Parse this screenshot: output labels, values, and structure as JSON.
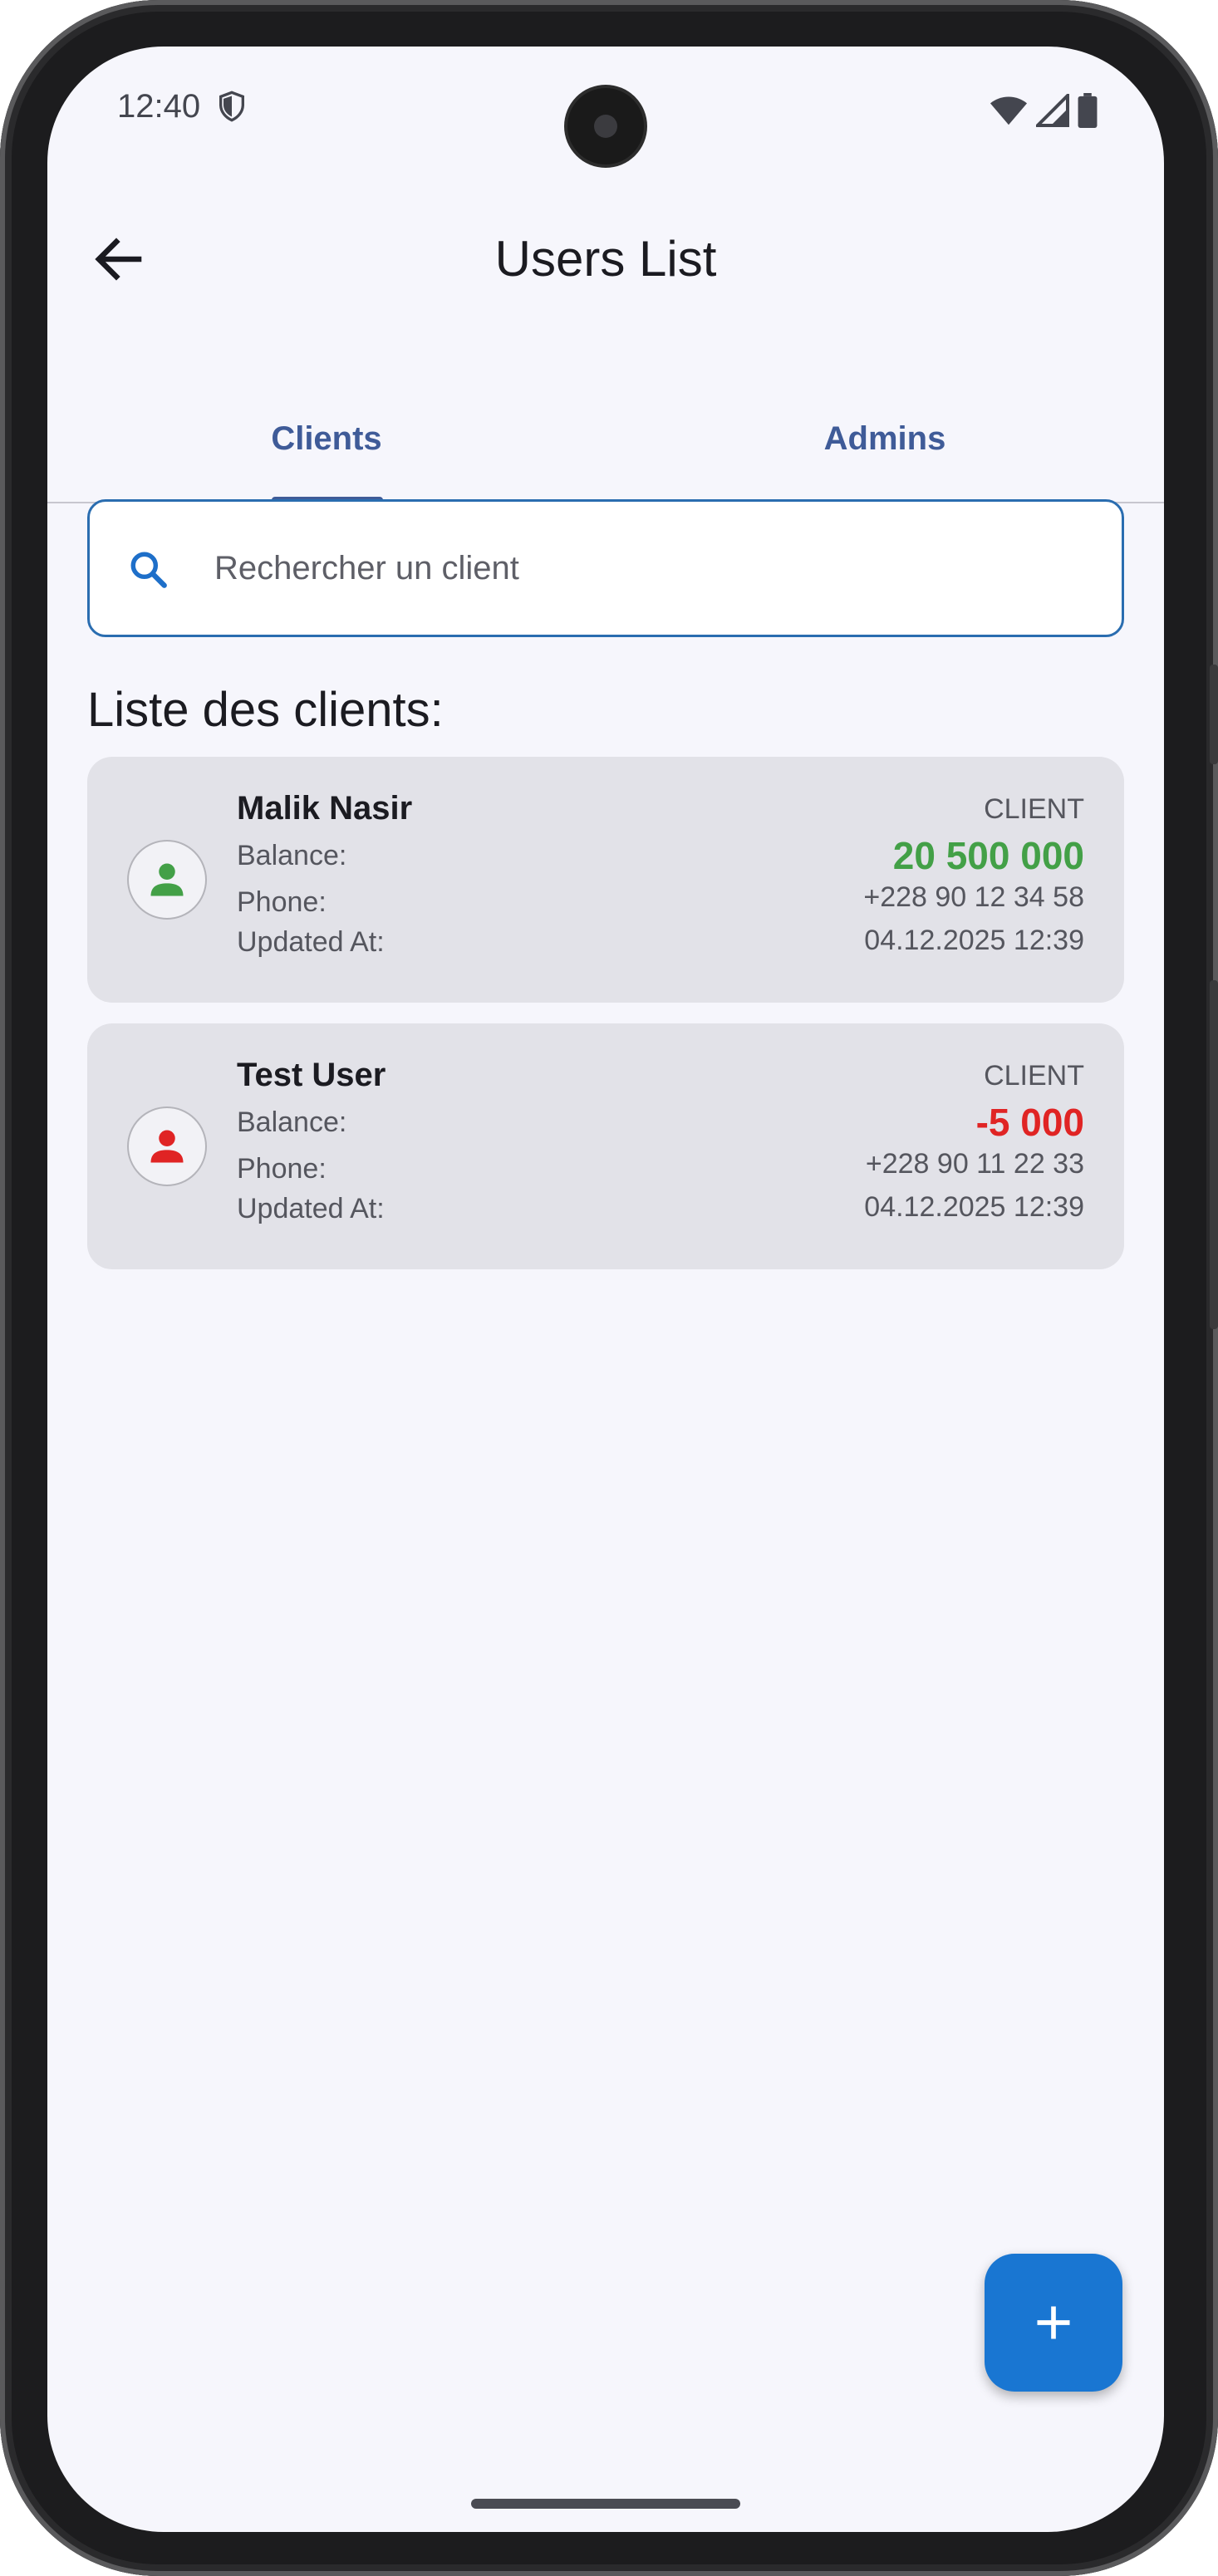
{
  "status_bar": {
    "time": "12:40"
  },
  "header": {
    "title": "Users List"
  },
  "tabs": [
    {
      "label": "Clients",
      "selected": true
    },
    {
      "label": "Admins",
      "selected": false
    }
  ],
  "search": {
    "placeholder": "Rechercher un client",
    "value": ""
  },
  "list": {
    "title": "Liste des clients:",
    "labels": {
      "balance": "Balance:",
      "phone": "Phone:",
      "updated": "Updated At:"
    },
    "clients": [
      {
        "name": "Malik Nasir",
        "role": "CLIENT",
        "balance": "20 500 000",
        "phone": "+228 90 12 34 58",
        "updated_at": "04.12.2025 12:39",
        "status_color": "#43a047"
      },
      {
        "name": "Test User",
        "role": "CLIENT",
        "balance": "-5 000",
        "phone": "+228 90 11 22 33",
        "updated_at": "04.12.2025 12:39",
        "status_color": "#e02424"
      }
    ]
  },
  "colors": {
    "accent": "#3f5b98",
    "fab": "#1976d2",
    "positive": "#43a047",
    "negative": "#e02424"
  }
}
